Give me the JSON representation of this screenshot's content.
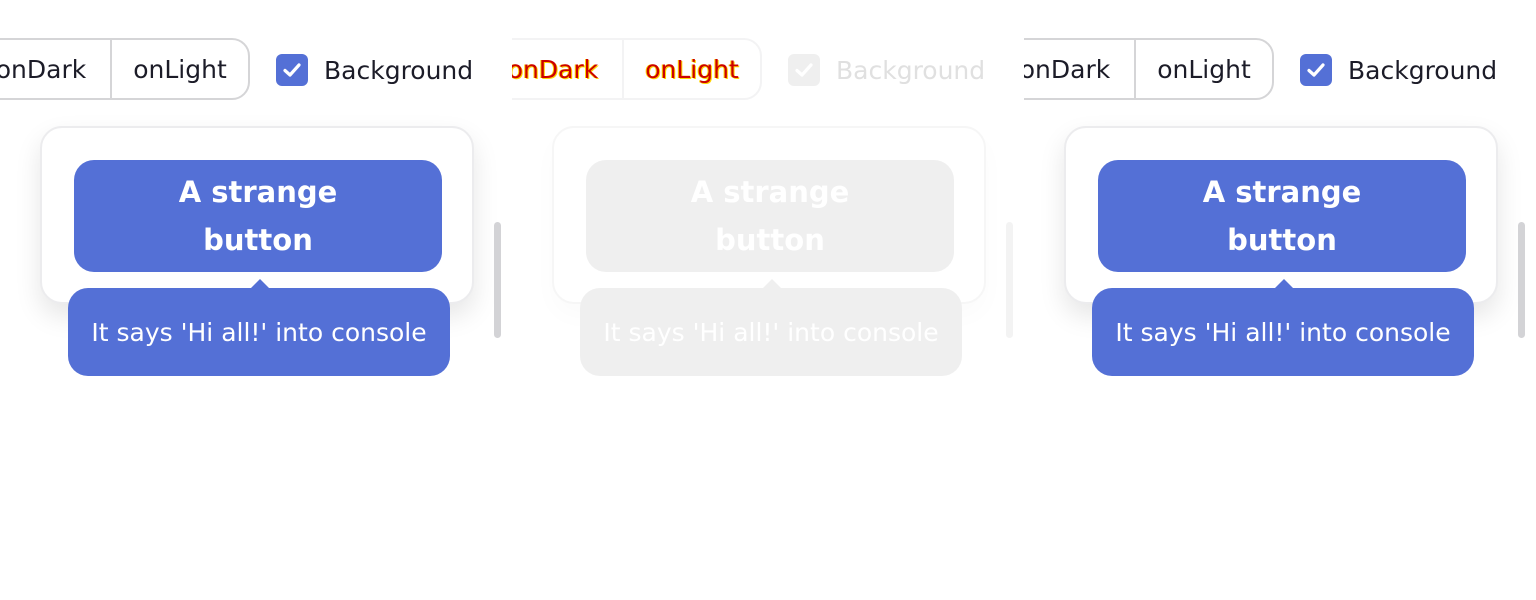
{
  "panels": [
    {
      "state": "normal",
      "theme_options": [
        "onDark",
        "onLight"
      ],
      "background_checkbox": {
        "label": "Background",
        "checked": true
      },
      "button_label": "A strange button",
      "tooltip": "It says 'Hi all!' into console"
    },
    {
      "state": "faded",
      "theme_options": [
        "onDark",
        "onLight"
      ],
      "background_checkbox": {
        "label": "Background",
        "checked": true
      },
      "button_label": "A strange button",
      "tooltip": "It says 'Hi all!' into console"
    },
    {
      "state": "normal",
      "theme_options": [
        "onDark",
        "onLight"
      ],
      "background_checkbox": {
        "label": "Background",
        "checked": true
      },
      "button_label": "A strange button",
      "tooltip": "It says 'Hi all!' into console"
    }
  ],
  "colors": {
    "accent": "#5470d6",
    "text": "#1c1c28",
    "border": "#d5d5d7",
    "faded": "#efefef"
  },
  "icons": {
    "checkbox": "checkmark-icon"
  }
}
